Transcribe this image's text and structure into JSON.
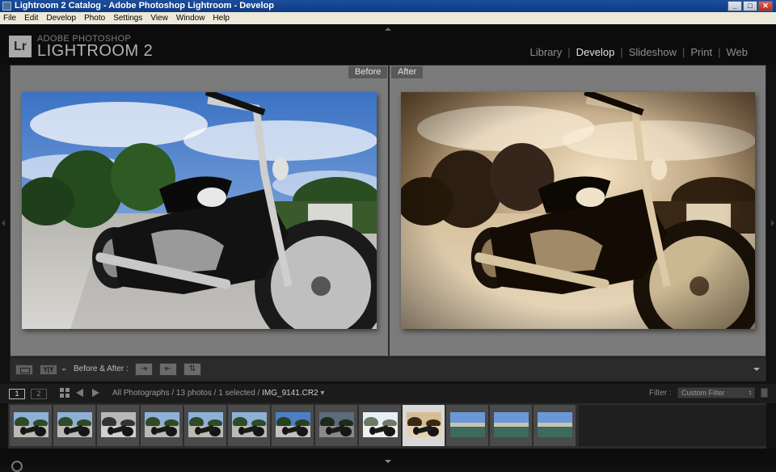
{
  "window": {
    "title": "Lightroom 2 Catalog - Adobe Photoshop Lightroom - Develop"
  },
  "menu": {
    "items": [
      "File",
      "Edit",
      "Develop",
      "Photo",
      "Settings",
      "View",
      "Window",
      "Help"
    ]
  },
  "brand": {
    "logo": "Lr",
    "line1": "ADOBE PHOTOSHOP",
    "line2": "LIGHTROOM 2"
  },
  "modules": {
    "items": [
      "Library",
      "Develop",
      "Slideshow",
      "Print",
      "Web"
    ],
    "active": "Develop"
  },
  "compare": {
    "before_label": "Before",
    "after_label": "After"
  },
  "toolbar": {
    "yy_label": "Y|Y",
    "before_after_label": "Before & After :"
  },
  "filmstrip_bar": {
    "window1": "1",
    "window2": "2",
    "source_prefix": "All Photographs / 13 photos / 1 selected /",
    "file_name": "IMG_9141.CR2",
    "filter_label": "Filter :",
    "filter_value": "Custom Filter"
  },
  "filmstrip": {
    "thumbnail_count": 13,
    "selected_index": 9,
    "thumbnail_kinds": [
      "bike-color",
      "bike-color",
      "bike-bw",
      "bike-color",
      "bike-color",
      "bike-color",
      "bike-sky",
      "bike-dark",
      "bike-bright",
      "bike-sepia",
      "harbor",
      "harbor",
      "harbor"
    ]
  },
  "colors": {
    "title_bar": "#1c4e9b",
    "panel_bg": "#7b7b7b",
    "selected_cell": "#d8d8d8",
    "active_module": "#e0e0e0"
  }
}
